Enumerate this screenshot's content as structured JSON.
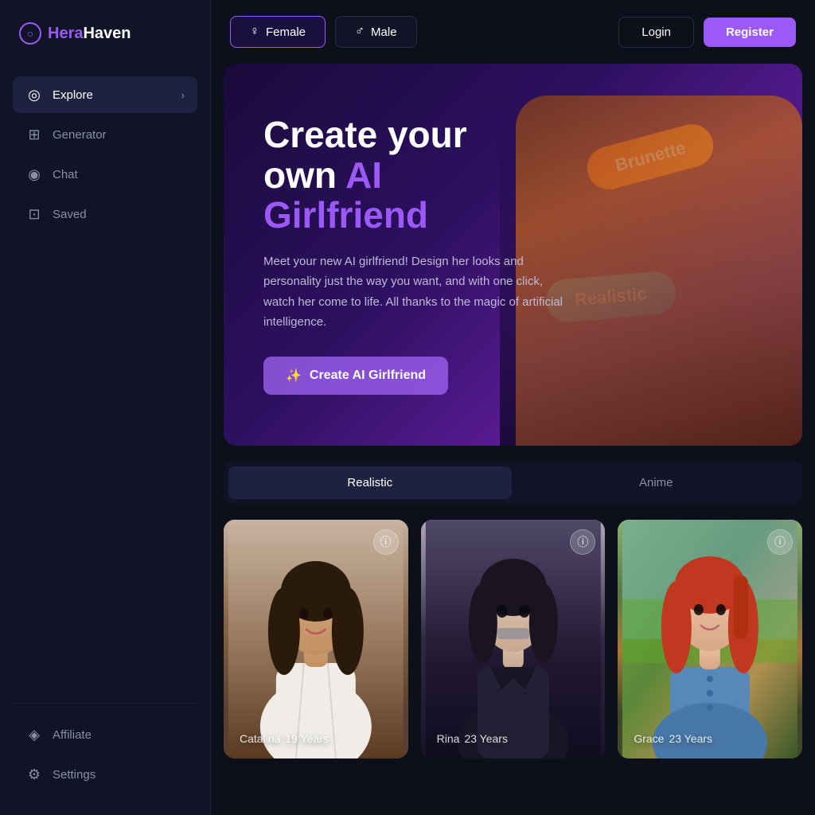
{
  "logo": {
    "icon": "○",
    "brand_part1": "Hera",
    "brand_part2": "Haven"
  },
  "sidebar": {
    "nav_items": [
      {
        "id": "explore",
        "label": "Explore",
        "icon": "◎",
        "active": true,
        "has_arrow": true
      },
      {
        "id": "generator",
        "label": "Generator",
        "icon": "⊞",
        "active": false,
        "has_arrow": false
      },
      {
        "id": "chat",
        "label": "Chat",
        "icon": "◉",
        "active": false,
        "has_arrow": false
      },
      {
        "id": "saved",
        "label": "Saved",
        "icon": "⊡",
        "active": false,
        "has_arrow": false
      }
    ],
    "bottom_items": [
      {
        "id": "affiliate",
        "label": "Affiliate",
        "icon": "◈"
      },
      {
        "id": "settings",
        "label": "Settings",
        "icon": "⚙"
      }
    ]
  },
  "header": {
    "gender_female": "Female",
    "gender_male": "Male",
    "login_label": "Login",
    "register_label": "Register"
  },
  "hero": {
    "title_line1": "Create your",
    "title_line2_plain": "own ",
    "title_line2_colored": "AI",
    "title_line3": "Girlfriend",
    "description": "Meet your new AI girlfriend! Design her looks and personality just the way you want, and with one click, watch her come to life. All thanks to the magic of artificial intelligence.",
    "cta_label": "Create AI Girlfriend",
    "pill1": "Brunette",
    "pill2": "Realistic"
  },
  "filter_tabs": [
    {
      "id": "realistic",
      "label": "Realistic",
      "active": true
    },
    {
      "id": "anime",
      "label": "Anime",
      "active": false
    }
  ],
  "cards": [
    {
      "id": "catalina",
      "name": "Catalina",
      "age": "19 Years"
    },
    {
      "id": "rina",
      "name": "Rina",
      "age": "23 Years"
    },
    {
      "id": "grace",
      "name": "Grace",
      "age": "23 Years"
    }
  ]
}
